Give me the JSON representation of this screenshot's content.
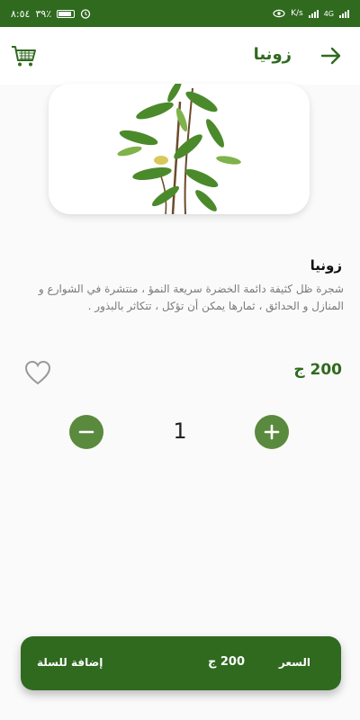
{
  "status_bar": {
    "time": "٨:٥٤",
    "battery": "٣٩٪",
    "network_speed": "K/s",
    "network_type": "4G"
  },
  "header": {
    "title": "زونيا"
  },
  "product": {
    "name": "زونيا",
    "description": "شجرة ظل كثيفة دائمة الخضرة سريعة النمؤ ، منتشرة في الشوارع و المنازل و الحدائق ، ثمارها يمكن أن تؤكل ، تتكاثر بالبذور .",
    "price": "200 ج",
    "quantity": "1"
  },
  "cart_bar": {
    "add_label": "إضافة للسلة",
    "price_label": "السعر",
    "price_value": "200 ج"
  },
  "colors": {
    "primary": "#2f6a1f",
    "button_green": "#5a8a3d"
  },
  "icons": [
    "back-arrow-icon",
    "cart-icon",
    "heart-icon",
    "minus-icon",
    "plus-icon"
  ]
}
